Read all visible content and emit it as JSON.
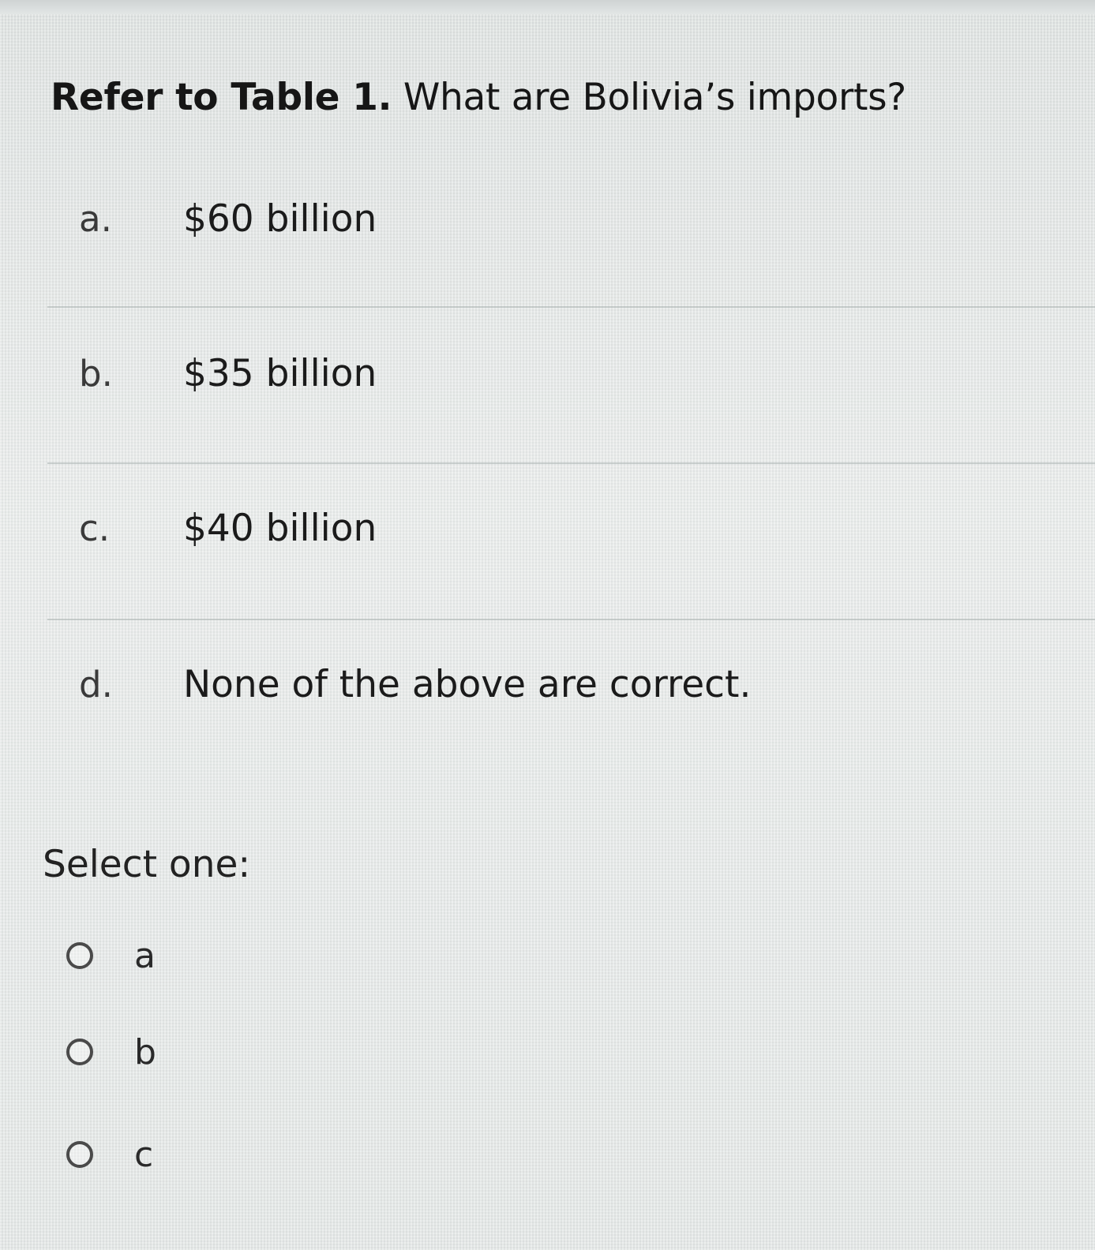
{
  "question": {
    "prefix": "Refer to Table 1.",
    "text": "What are Bolivia’s imports?"
  },
  "options": [
    {
      "letter": "a.",
      "text": "$60 billion"
    },
    {
      "letter": "b.",
      "text": "$35 billion"
    },
    {
      "letter": "c.",
      "text": "$40 billion"
    },
    {
      "letter": "d.",
      "text": "None of the above are correct."
    }
  ],
  "select_prompt": "Select one:",
  "choices": [
    {
      "label": "a",
      "selected": false
    },
    {
      "label": "b",
      "selected": false
    },
    {
      "label": "c",
      "selected": false
    }
  ]
}
